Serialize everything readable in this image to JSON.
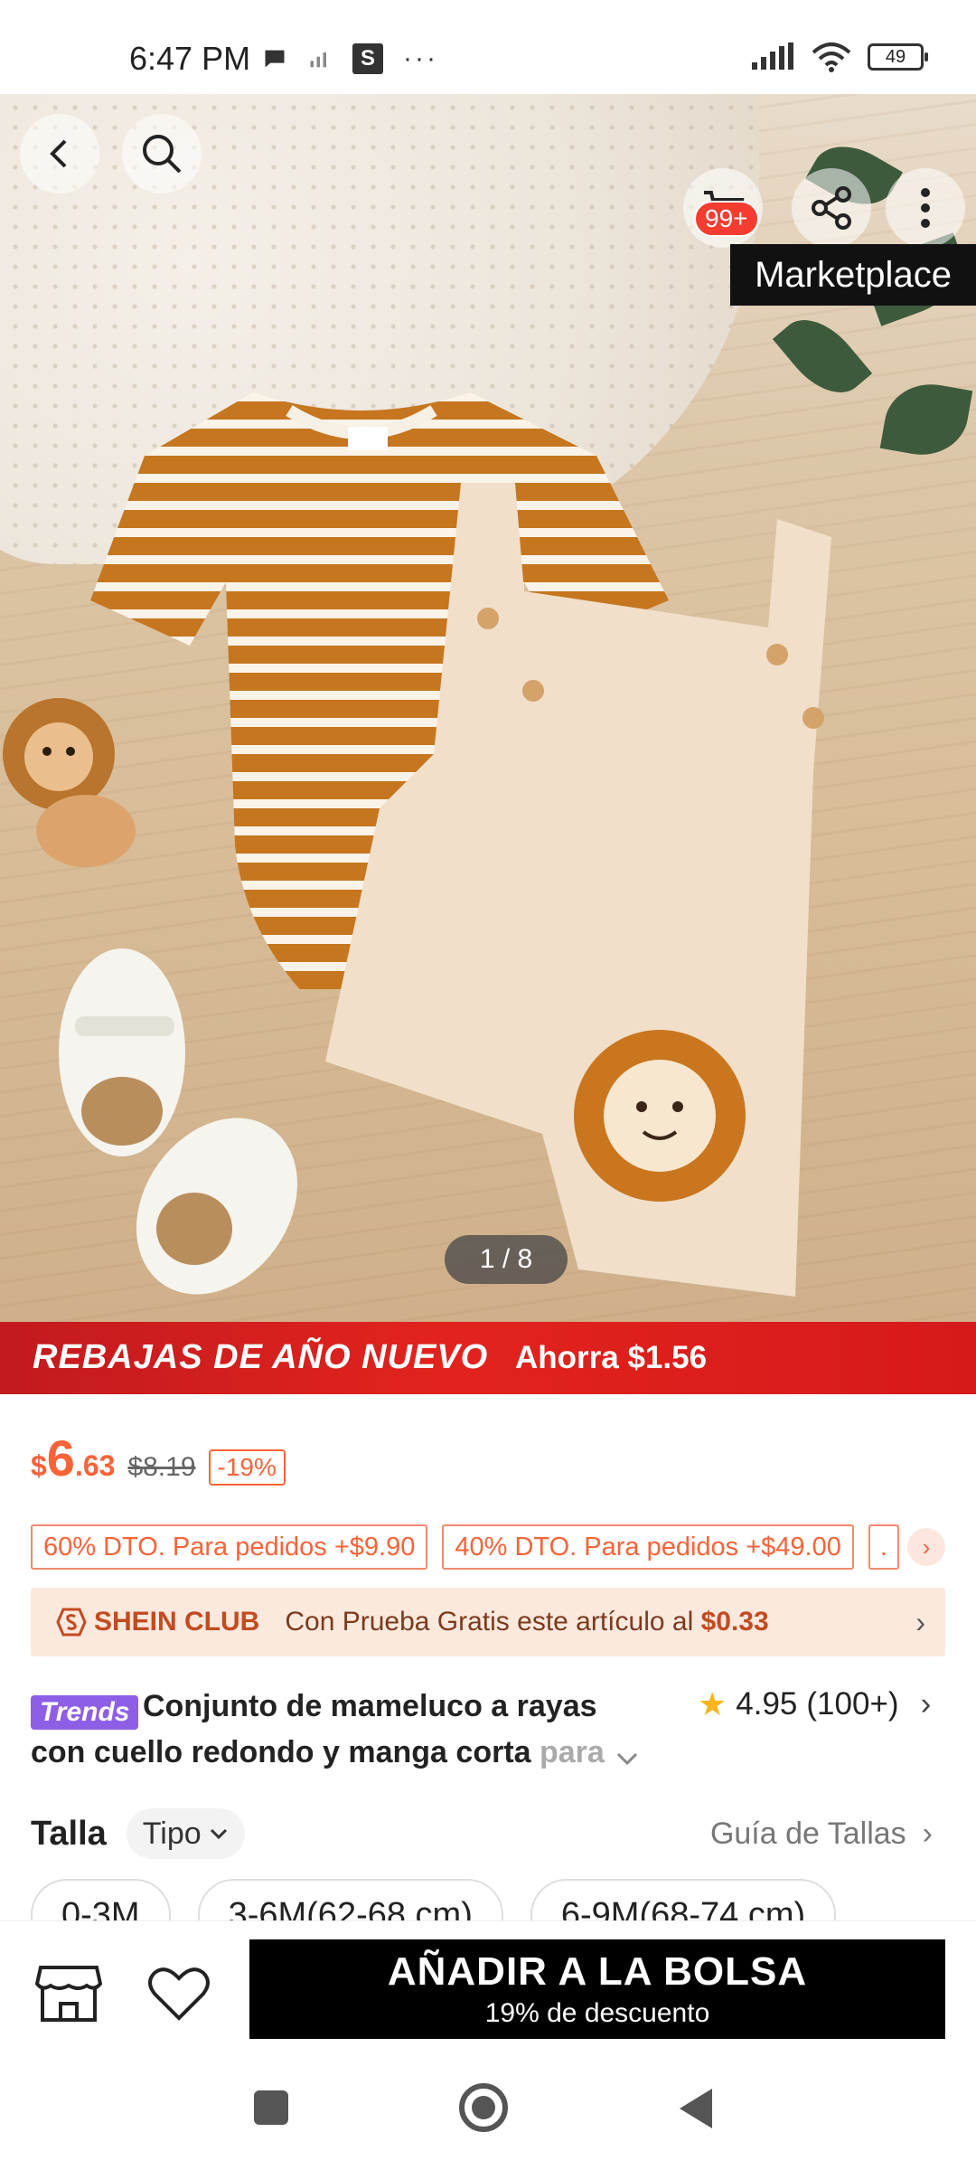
{
  "status_bar": {
    "time": "6:47 PM",
    "battery": "49",
    "icons": [
      "chat-icon",
      "signal-icon",
      "s-app-icon",
      "more-dots",
      "cell-signal-icon",
      "wifi-icon",
      "battery-icon"
    ],
    "s_app_letter": "S",
    "more_dots": "···"
  },
  "header": {
    "cart_badge": "99+",
    "marketplace_label": "Marketplace",
    "image_counter": "1 / 8"
  },
  "promo": {
    "title": "REBAJAS DE AÑO NUEVO",
    "savings": "Ahorra $1.56",
    "colors": {
      "banner": "#d91c1f"
    }
  },
  "price": {
    "currency": "$",
    "integer": "6",
    "decimal": ".63",
    "original": "$8.19",
    "discount": "-19%",
    "color": "#fa6338"
  },
  "coupons": [
    {
      "label": "60% DTO. Para pedidos +$9.90"
    },
    {
      "label": "40% DTO. Para pedidos +$49.00"
    },
    {
      "label": "."
    }
  ],
  "club": {
    "name": "SHEIN CLUB",
    "text_prefix": "Con Prueba Gratis este artículo al ",
    "price": "$0.33"
  },
  "product": {
    "trend_tag": "Trends",
    "title_main": "Conjunto de mameluco a rayas con cuello redondo y manga corta",
    "title_fade": " para",
    "rating": "4.95",
    "reviews": "(100+)"
  },
  "size": {
    "label": "Talla",
    "type_select": "Tipo",
    "guide": "Guía de Tallas",
    "options": [
      "0-3M",
      "3-6M(62-68 cm)",
      "6-9M(68-74 cm)"
    ]
  },
  "bottom": {
    "add_to_bag": "AÑADIR A LA BOLSA",
    "add_to_bag_sub": "19% de descuento"
  }
}
